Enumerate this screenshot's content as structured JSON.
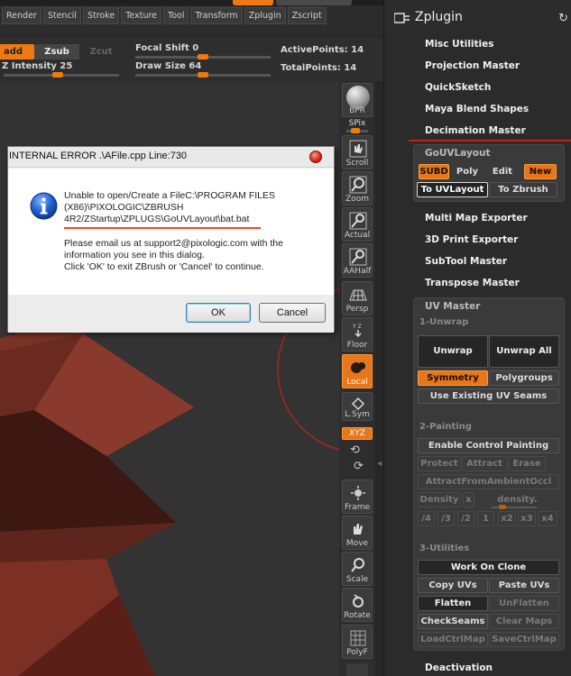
{
  "menu": {
    "items": [
      "Render",
      "Stencil",
      "Stroke",
      "Texture",
      "Tool",
      "Transform",
      "Zplugin",
      "Zscript"
    ]
  },
  "draw_options": {
    "add_label": "add",
    "zsub_label": "Zsub",
    "zcut_label": "Zcut",
    "z_intensity_label": "Z Intensity",
    "z_intensity_value": "25",
    "focal_shift_label": "Focal Shift",
    "focal_shift_value": "0",
    "draw_size_label": "Draw Size",
    "draw_size_value": "64",
    "active_points_label": "ActivePoints:",
    "active_points_value": "14",
    "total_points_label": "TotalPoints:",
    "total_points_value": "14"
  },
  "shelf": {
    "items": [
      "BPR",
      "SPix",
      "Scroll",
      "Zoom",
      "Actual",
      "AAHalf",
      "Persp",
      "Floor",
      "Local",
      "L.Sym",
      "XYZ",
      "Frame",
      "Move",
      "Scale",
      "Rotate",
      "PolyF"
    ]
  },
  "panel": {
    "title": "Zplugin",
    "plugins_top": [
      "Misc Utilities",
      "Projection Master",
      "QuickSketch",
      "Maya Blend Shapes",
      "Decimation Master"
    ],
    "gouv": {
      "title": "GoUVLayout",
      "subd": "SUBD",
      "poly": "Poly",
      "edit": "Edit",
      "new": "New",
      "to_uvlayout": "To UVLayout",
      "to_zbrush": "To Zbrush"
    },
    "plugins_mid": [
      "Multi Map Exporter",
      "3D Print Exporter",
      "SubTool Master",
      "Transpose Master"
    ],
    "uvmaster": {
      "title": "UV Master",
      "section1": "1-Unwrap",
      "unwrap": "Unwrap",
      "unwrap_all": "Unwrap All",
      "symmetry": "Symmetry",
      "polygroups": "Polygroups",
      "use_existing": "Use Existing UV Seams",
      "section2": "2-Painting",
      "enable_control": "Enable Control Painting",
      "protect": "Protect",
      "attract": "Attract",
      "erase": "Erase",
      "attract_ambient": "AttractFromAmbientOccl",
      "density": "Density",
      "density_x": "x",
      "density_slider": "density.",
      "density_options": [
        "/4",
        "/3",
        "/2",
        "1",
        "x2",
        "x3",
        "x4"
      ],
      "section3": "3-Utilities",
      "work_on_clone": "Work On Clone",
      "copy_uvs": "Copy UVs",
      "paste_uvs": "Paste UVs",
      "flatten": "Flatten",
      "unflatten": "UnFlatten",
      "checkseams": "CheckSeams",
      "clear_maps": "Clear Maps",
      "loadctrlmap": "LoadCtrlMap",
      "savectrlmap": "SaveCtrlMap"
    },
    "deactivation": "Deactivation"
  },
  "dialog": {
    "title": "INTERNAL ERROR .\\AFile.cpp  Line:730",
    "line1": "Unable to open/Create a FileC:\\PROGRAM FILES",
    "line2": "(X86)\\PIXOLOGIC\\ZBRUSH",
    "line3": "4R2/ZStartup\\ZPLUGS\\GoUVLayout\\bat.bat",
    "line4": "Please email us at support2@pixologic.com with the",
    "line5": "information you see in this dialog.",
    "line6": "Click 'OK' to exit ZBrush or 'Cancel' to continue.",
    "ok_label": "OK",
    "cancel_label": "Cancel"
  },
  "colors": {
    "accent": "#f07a12",
    "highlight_line": "#d0191e",
    "mesh": "#8a3a2c"
  }
}
